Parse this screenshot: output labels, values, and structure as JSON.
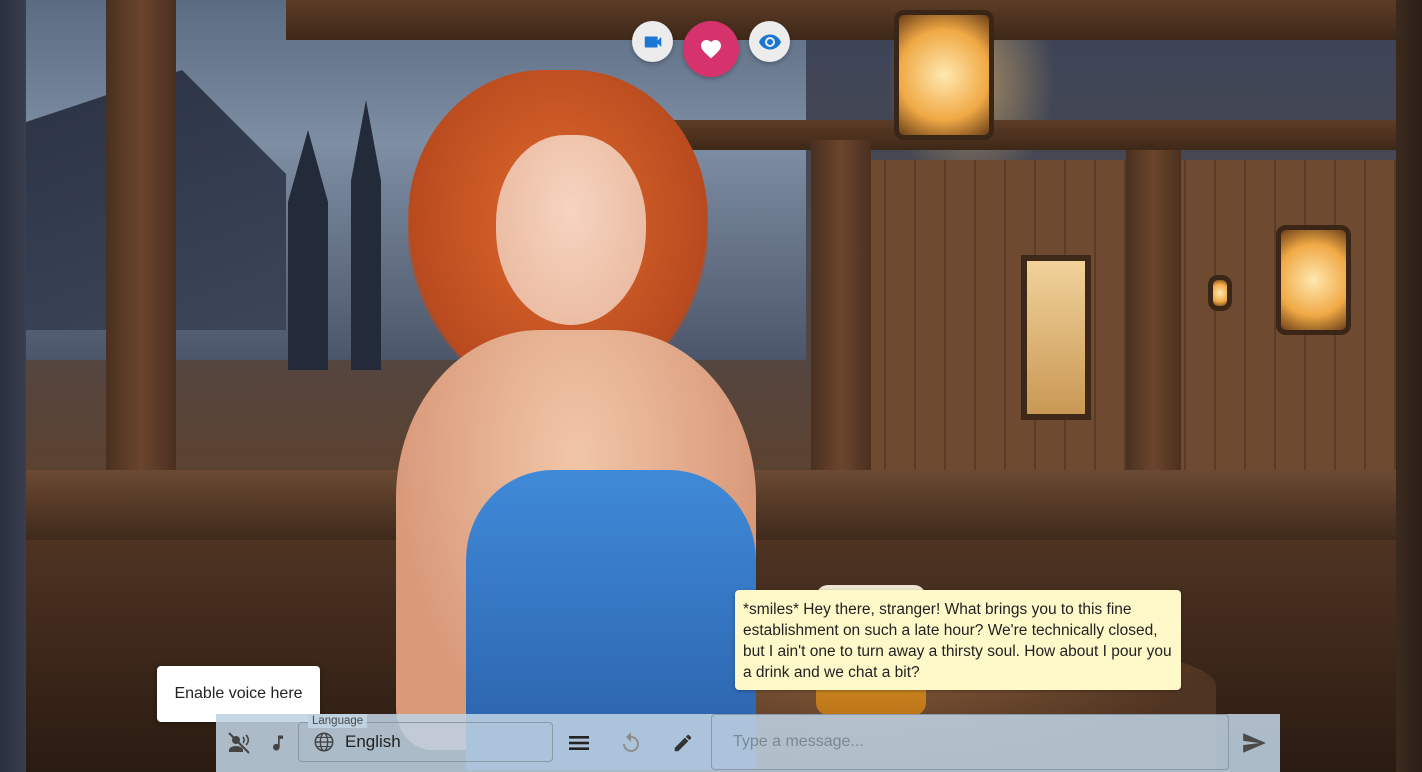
{
  "top_actions": {
    "video_icon": "videocam-icon",
    "heart_icon": "heart-icon",
    "eye_icon": "eye-icon",
    "heart_color": "#d6336c"
  },
  "chat": {
    "message": "*smiles* Hey there, stranger! What brings you to this fine establishment on such a late hour? We're technically closed, but I ain't one to turn away a thirsty soul. How about I pour you a drink and we chat a bit?"
  },
  "tooltip": {
    "text": "Enable voice here"
  },
  "bottom_bar": {
    "voice_icon": "voice-off-icon",
    "music_icon": "music-note-icon",
    "language_label": "Language",
    "language_icon": "globe-icon",
    "language_value": "English",
    "menu_icon": "menu-icon",
    "regenerate_icon": "refresh-icon",
    "edit_icon": "pencil-icon",
    "input_placeholder": "Type a message...",
    "send_icon": "send-icon"
  }
}
